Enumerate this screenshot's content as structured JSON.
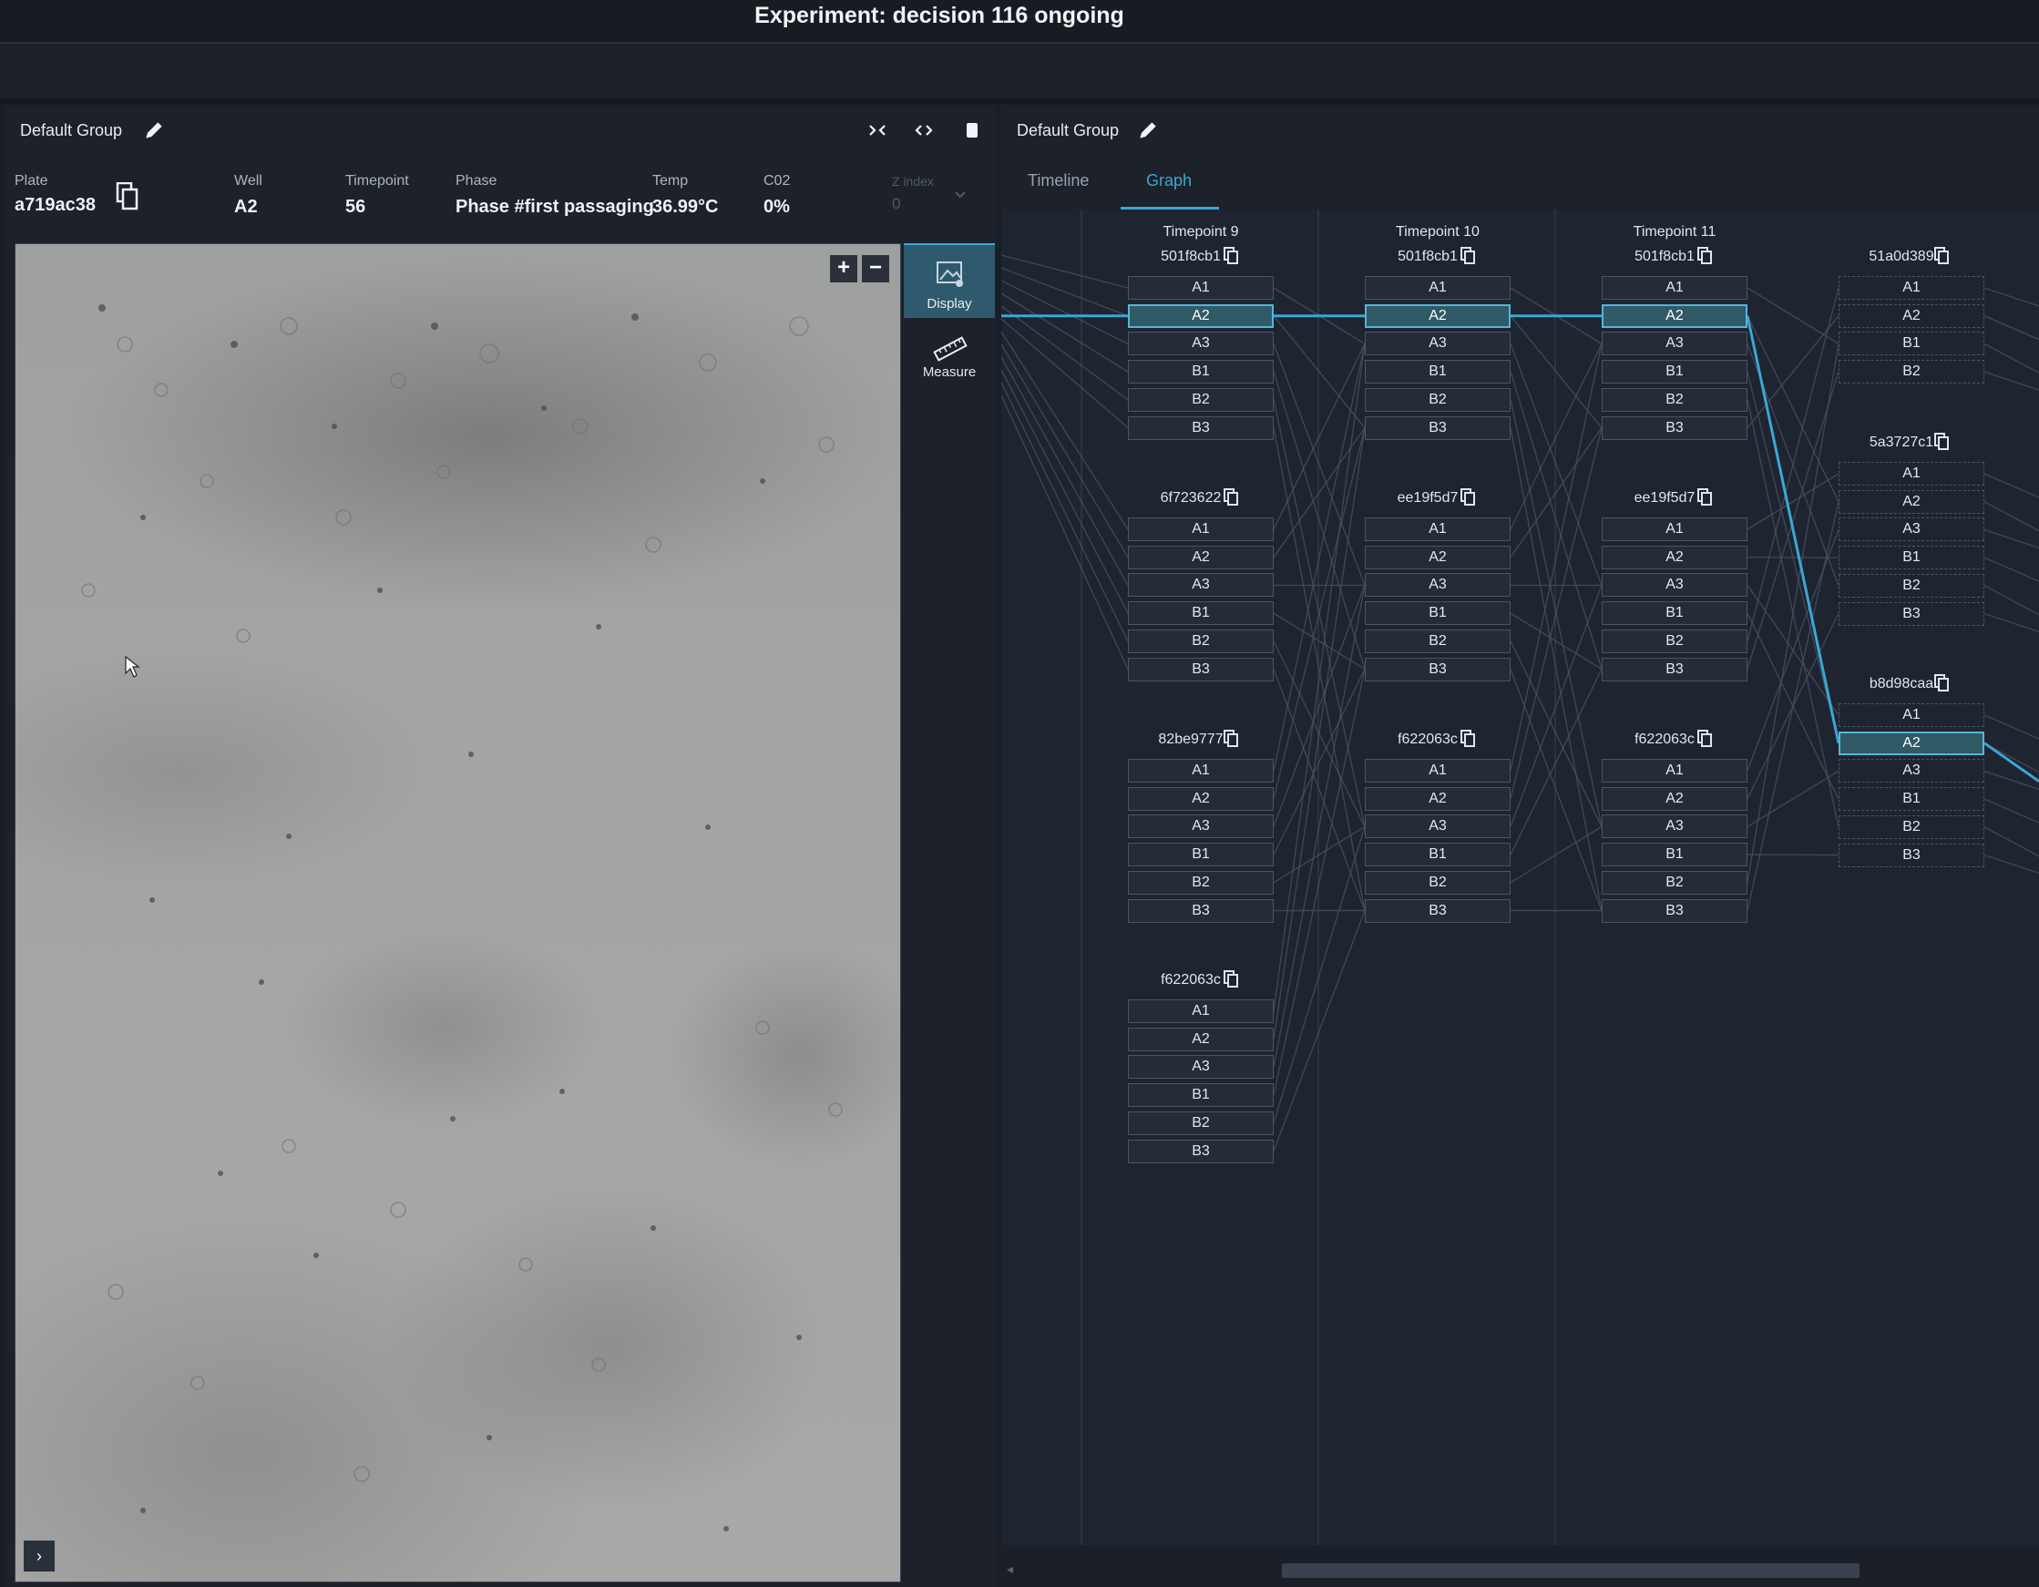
{
  "app": {
    "title": "Experiment: decision 116 ongoing"
  },
  "left_panel": {
    "group_title": "Default Group",
    "meta": {
      "plate_label": "Plate",
      "plate_value": "a719ac38",
      "well_label": "Well",
      "well_value": "A2",
      "timepoint_label": "Timepoint",
      "timepoint_value": "56",
      "phase_label": "Phase",
      "phase_value": "Phase #first passaging",
      "temp_label": "Temp",
      "temp_value": "36.99°C",
      "co2_label": "C02",
      "co2_value": "0%",
      "zindex_label": "Z index",
      "zindex_value": "0"
    },
    "tools": {
      "display": "Display",
      "measure": "Measure"
    },
    "zoom_in": "+",
    "zoom_out": "−",
    "expand": "›"
  },
  "right_panel": {
    "group_title": "Default Group",
    "tabs": [
      {
        "label": "Timeline",
        "active": false
      },
      {
        "label": "Graph",
        "active": true
      }
    ],
    "columns": [
      {
        "header": "Timepoint 9",
        "plates": [
          {
            "id": "501f8cb1",
            "wells": [
              "A1",
              "A2",
              "A3",
              "B1",
              "B2",
              "B3"
            ],
            "selected": "A2",
            "dashed": false
          },
          {
            "id": "6f723622",
            "wells": [
              "A1",
              "A2",
              "A3",
              "B1",
              "B2",
              "B3"
            ],
            "selected": null,
            "dashed": false
          },
          {
            "id": "82be9777",
            "wells": [
              "A1",
              "A2",
              "A3",
              "B1",
              "B2",
              "B3"
            ],
            "selected": null,
            "dashed": false
          },
          {
            "id": "f622063c",
            "wells": [
              "A1",
              "A2",
              "A3",
              "B1",
              "B2",
              "B3"
            ],
            "selected": null,
            "dashed": false
          }
        ]
      },
      {
        "header": "Timepoint 10",
        "plates": [
          {
            "id": "501f8cb1",
            "wells": [
              "A1",
              "A2",
              "A3",
              "B1",
              "B2",
              "B3"
            ],
            "selected": "A2",
            "dashed": false
          },
          {
            "id": "ee19f5d7",
            "wells": [
              "A1",
              "A2",
              "A3",
              "B1",
              "B2",
              "B3"
            ],
            "selected": null,
            "dashed": false
          },
          {
            "id": "f622063c",
            "wells": [
              "A1",
              "A2",
              "A3",
              "B1",
              "B2",
              "B3"
            ],
            "selected": null,
            "dashed": false
          }
        ]
      },
      {
        "header": "Timepoint 11",
        "plates": [
          {
            "id": "501f8cb1",
            "wells": [
              "A1",
              "A2",
              "A3",
              "B1",
              "B2",
              "B3"
            ],
            "selected": "A2",
            "dashed": false
          },
          {
            "id": "ee19f5d7",
            "wells": [
              "A1",
              "A2",
              "A3",
              "B1",
              "B2",
              "B3"
            ],
            "selected": null,
            "dashed": false
          },
          {
            "id": "f622063c",
            "wells": [
              "A1",
              "A2",
              "A3",
              "B1",
              "B2",
              "B3"
            ],
            "selected": null,
            "dashed": false
          }
        ]
      },
      {
        "header": "",
        "plates": [
          {
            "id": "51a0d389",
            "wells": [
              "A1",
              "A2",
              "B1",
              "B2"
            ],
            "selected": null,
            "dashed": true
          },
          {
            "id": "5a3727c1",
            "wells": [
              "A1",
              "A2",
              "A3",
              "B1",
              "B2",
              "B3"
            ],
            "selected": null,
            "dashed": true
          },
          {
            "id": "b8d98caa",
            "wells": [
              "A1",
              "A2",
              "A3",
              "B1",
              "B2",
              "B3"
            ],
            "selected": "A2",
            "dashed": true
          }
        ]
      }
    ],
    "colors": {
      "accent": "#3aa7d6",
      "selected_fill": "#2f5a66",
      "edge": "#4a5260"
    }
  }
}
